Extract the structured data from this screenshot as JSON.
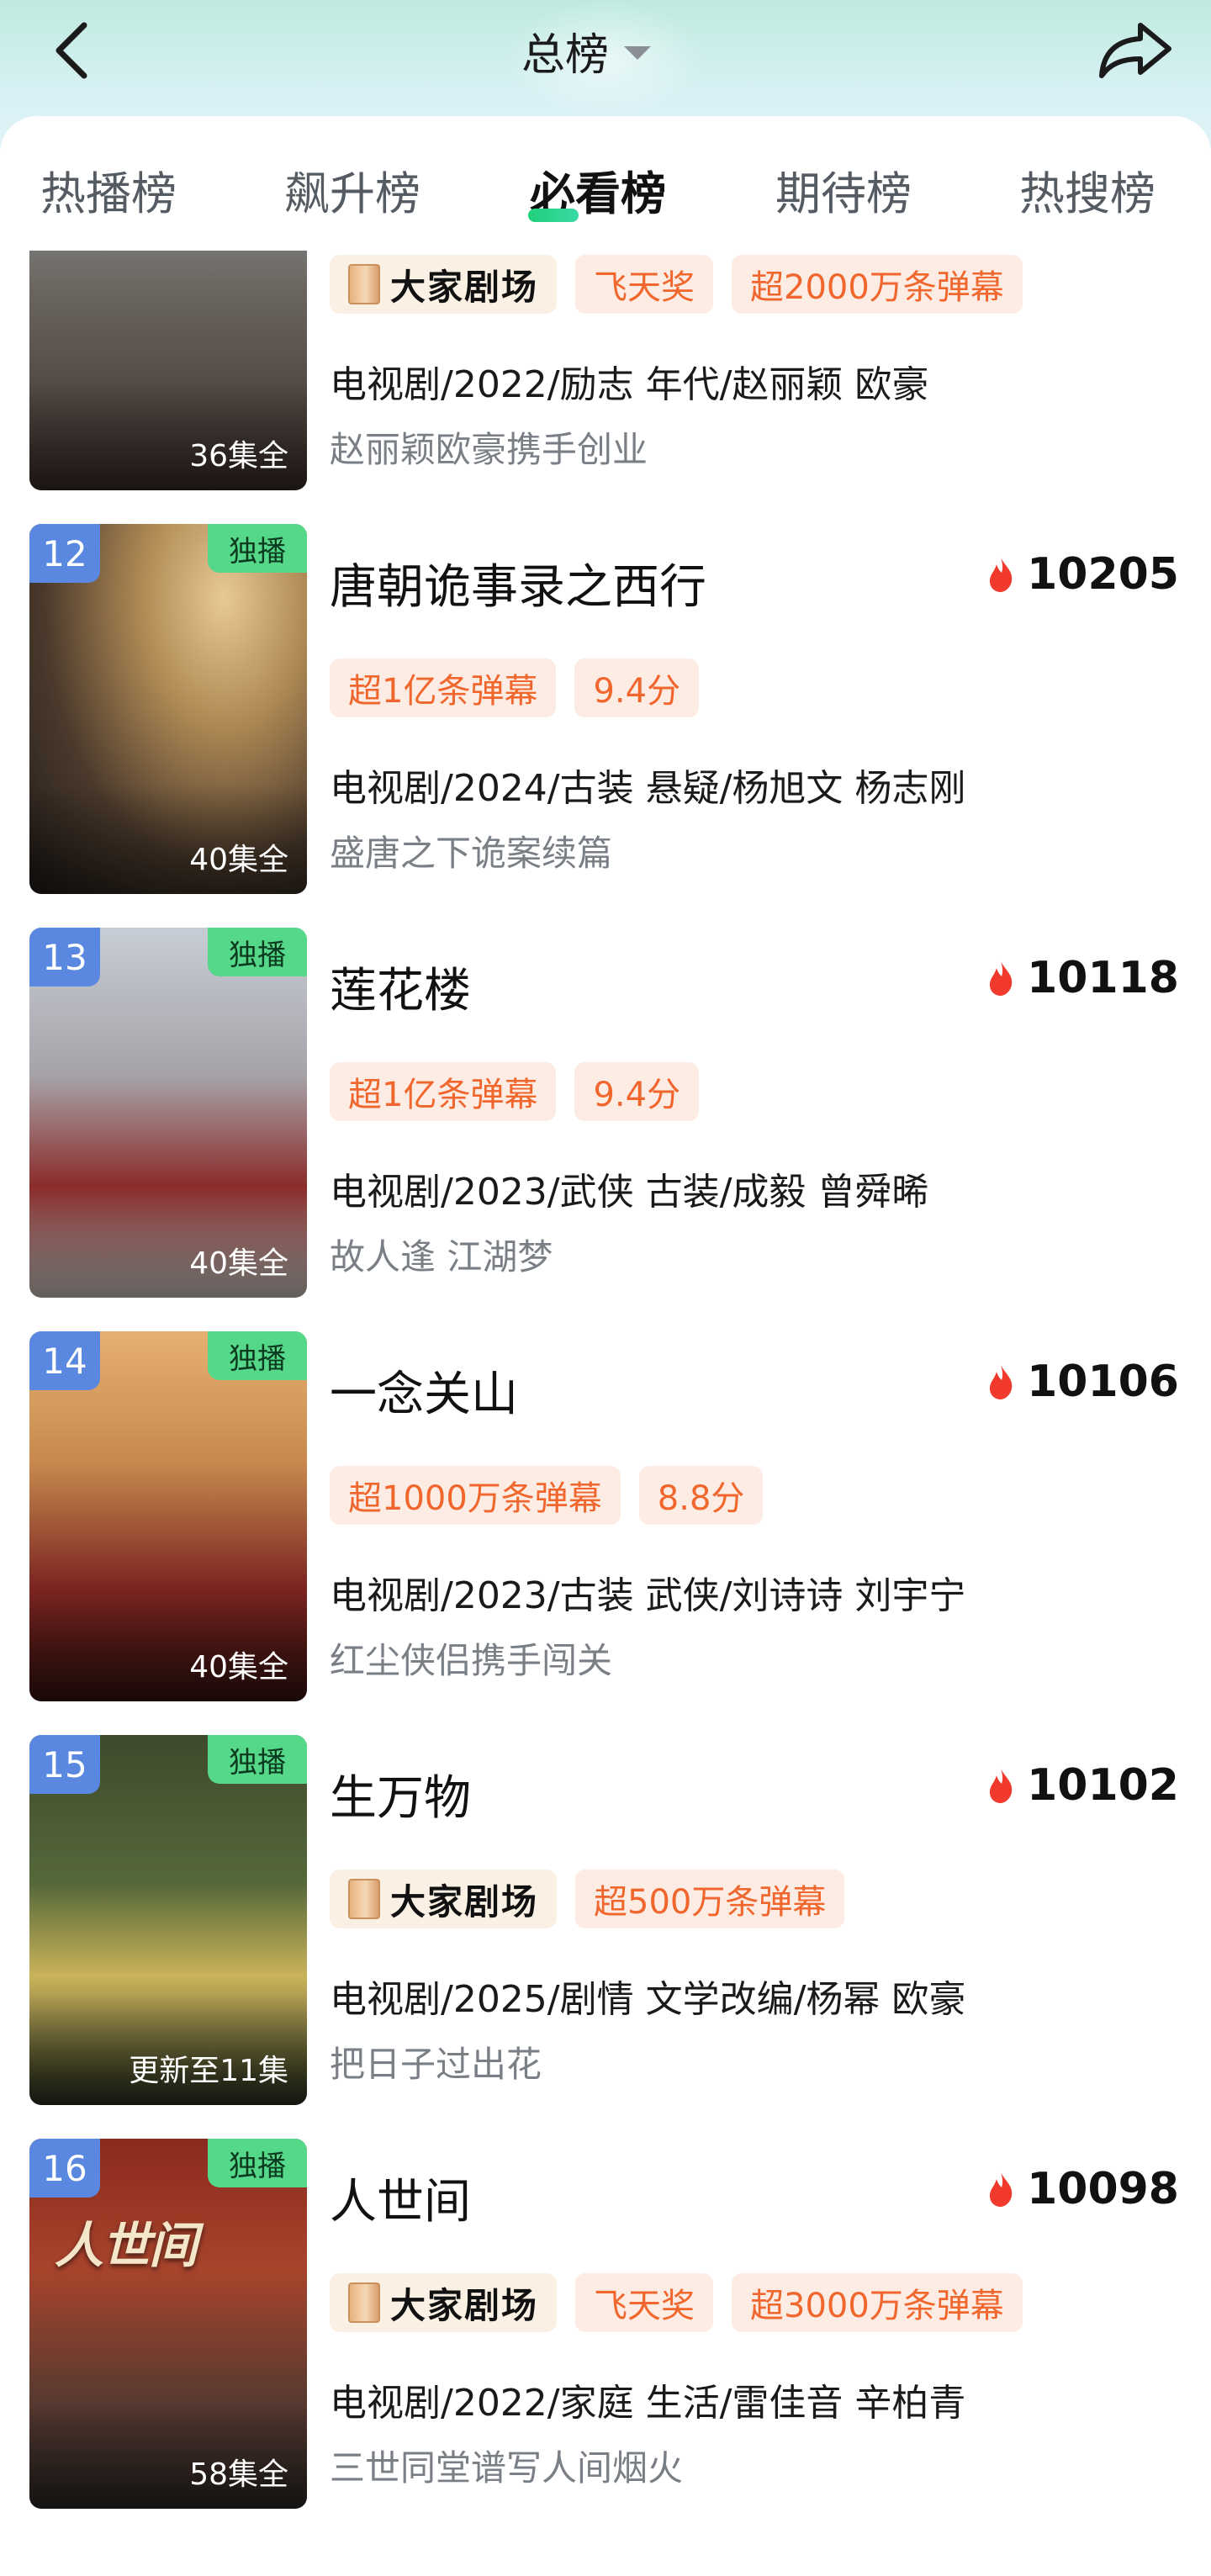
{
  "header": {
    "title": "总榜",
    "back_icon": "chevron-left-icon",
    "share_icon": "share-arrow-icon"
  },
  "tabs": [
    "热播榜",
    "飙升榜",
    "必看榜",
    "期待榜",
    "热搜榜"
  ],
  "active_tab": "必看榜",
  "items": [
    {
      "rank": "",
      "title": "",
      "heat": "",
      "exclusive": "",
      "episodes": "36集全",
      "poster_text": "",
      "brand": "大家剧场",
      "tags": [
        "飞天奖",
        "超2000万条弹幕"
      ],
      "meta": "电视剧/2022/励志 年代/赵丽颖 欧豪",
      "desc": "赵丽颖欧豪携手创业"
    },
    {
      "rank": "12",
      "title": "唐朝诡事录之西行",
      "heat": "10205",
      "exclusive": "独播",
      "episodes": "40集全",
      "poster_text": "",
      "brand": "",
      "tags": [
        "超1亿条弹幕",
        "9.4分"
      ],
      "meta": "电视剧/2024/古装 悬疑/杨旭文 杨志刚",
      "desc": "盛唐之下诡案续篇"
    },
    {
      "rank": "13",
      "title": "莲花楼",
      "heat": "10118",
      "exclusive": "独播",
      "episodes": "40集全",
      "poster_text": "",
      "brand": "",
      "tags": [
        "超1亿条弹幕",
        "9.4分"
      ],
      "meta": "电视剧/2023/武侠 古装/成毅 曾舜晞",
      "desc": "故人逢 江湖梦"
    },
    {
      "rank": "14",
      "title": "一念关山",
      "heat": "10106",
      "exclusive": "独播",
      "episodes": "40集全",
      "poster_text": "",
      "brand": "",
      "tags": [
        "超1000万条弹幕",
        "8.8分"
      ],
      "meta": "电视剧/2023/古装 武侠/刘诗诗 刘宇宁",
      "desc": "红尘侠侣携手闯关"
    },
    {
      "rank": "15",
      "title": "生万物",
      "heat": "10102",
      "exclusive": "独播",
      "episodes": "更新至11集",
      "poster_text": "",
      "brand": "大家剧场",
      "tags": [
        "超500万条弹幕"
      ],
      "meta": "电视剧/2025/剧情 文学改编/杨幂 欧豪",
      "desc": "把日子过出花"
    },
    {
      "rank": "16",
      "title": "人世间",
      "heat": "10098",
      "exclusive": "独播",
      "episodes": "58集全",
      "poster_text": "人世间",
      "brand": "大家剧场",
      "tags": [
        "飞天奖",
        "超3000万条弹幕"
      ],
      "meta": "电视剧/2022/家庭 生活/雷佳音 辛柏青",
      "desc": "三世同堂谱写人间烟火"
    }
  ],
  "colors": {
    "accent_green": "#3cd9a6",
    "tag_orange": "#f0662c",
    "rank_blue": "#5a88e0",
    "heat_red": "#f23a2c"
  }
}
